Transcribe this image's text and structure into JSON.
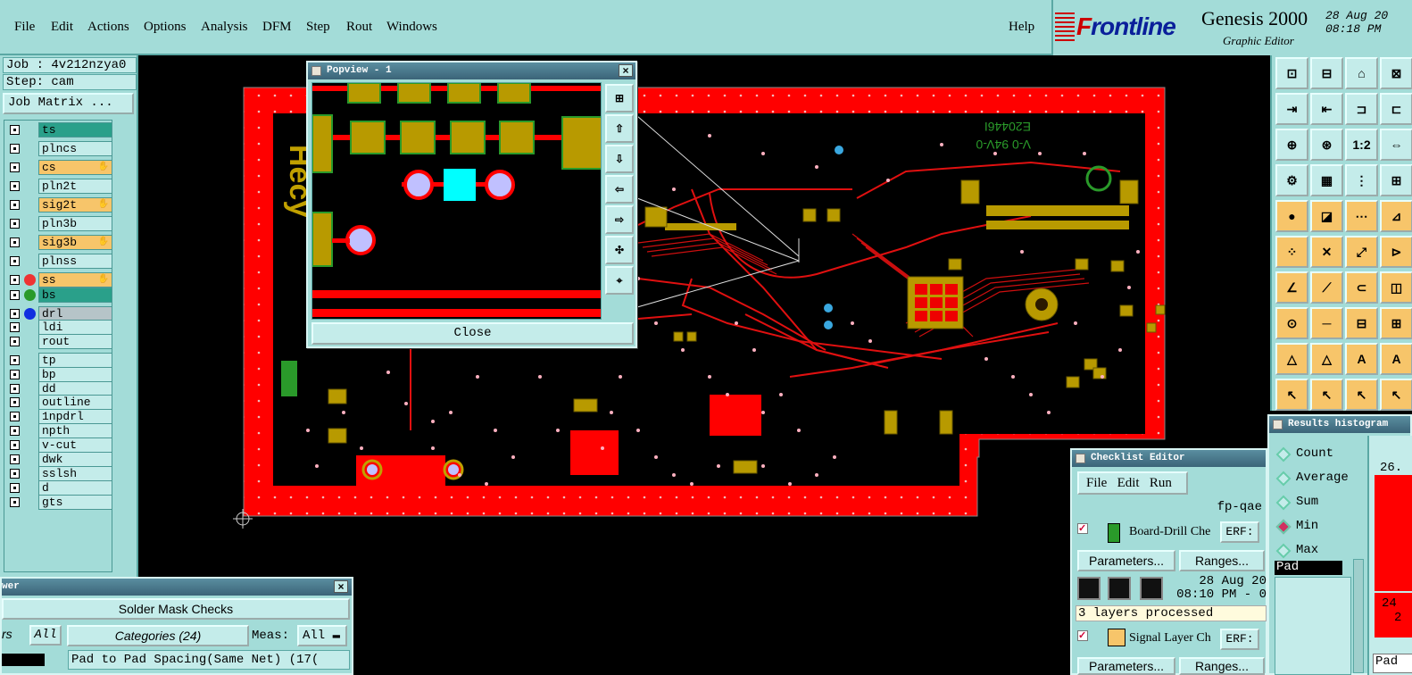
{
  "menu": {
    "items": [
      "File",
      "Edit",
      "Actions",
      "Options",
      "Analysis",
      "DFM",
      "Step",
      "Rout",
      "Windows"
    ],
    "help": "Help"
  },
  "brand": {
    "logo_prefix": "F",
    "logo_rest": "rontline",
    "product": "Genesis 2000",
    "subtitle": "Graphic Editor",
    "date": "28 Aug 20",
    "time": "08:18 PM"
  },
  "job": {
    "job_label": "Job : 4v212nzya0",
    "step_label": "Step: cam",
    "matrix_button": "Job Matrix ..."
  },
  "layers": [
    {
      "name": "ts",
      "color": "#2aa08a",
      "dot": ""
    },
    {
      "name": "plncs",
      "color": "#c4ecea",
      "dot": ""
    },
    {
      "name": "cs",
      "color": "#f7c56a",
      "dot": "",
      "hand": true
    },
    {
      "name": "pln2t",
      "color": "#c4ecea",
      "dot": ""
    },
    {
      "name": "sig2t",
      "color": "#f7c56a",
      "dot": "",
      "hand": true
    },
    {
      "name": "pln3b",
      "color": "#c4ecea",
      "dot": ""
    },
    {
      "name": "sig3b",
      "color": "#f7c56a",
      "dot": "",
      "hand": true
    },
    {
      "name": "plnss",
      "color": "#c4ecea",
      "dot": ""
    },
    {
      "name": "ss",
      "color": "#f7c56a",
      "dot": "#e33",
      "hand": true
    },
    {
      "name": "bs",
      "color": "#2aa08a",
      "dot": "#2a9a2a"
    },
    {
      "name": "drl",
      "color": "#b6c4c8",
      "dot": "#1030e0"
    },
    {
      "name": "ldi",
      "color": "#c4ecea",
      "dot": ""
    },
    {
      "name": "rout",
      "color": "#c4ecea",
      "dot": ""
    },
    {
      "name": "tp",
      "color": "#c4ecea",
      "dot": ""
    },
    {
      "name": "bp",
      "color": "#c4ecea",
      "dot": ""
    },
    {
      "name": "dd",
      "color": "#c4ecea",
      "dot": ""
    },
    {
      "name": "outline",
      "color": "#c4ecea",
      "dot": ""
    },
    {
      "name": "1npdrl",
      "color": "#c4ecea",
      "dot": ""
    },
    {
      "name": "npth",
      "color": "#c4ecea",
      "dot": ""
    },
    {
      "name": "v-cut",
      "color": "#c4ecea",
      "dot": ""
    },
    {
      "name": "dwk",
      "color": "#c4ecea",
      "dot": ""
    },
    {
      "name": "sslsh",
      "color": "#c4ecea",
      "dot": ""
    },
    {
      "name": "d",
      "color": "#c4ecea",
      "dot": ""
    },
    {
      "name": "gts",
      "color": "#c4ecea",
      "dot": ""
    }
  ],
  "popview": {
    "title": "Popview - 1",
    "close_label": "Close"
  },
  "checker": {
    "title_fragment": "wer",
    "section": "Solder Mask Checks",
    "rs_fragment": "rs",
    "all_button": "All",
    "categories": "Categories (24)",
    "meas_label": "Meas:",
    "meas_value": "All",
    "row1": "Pad to Pad Spacing(Same Net) (17("
  },
  "checklist": {
    "title": "Checklist Editor",
    "menu": [
      "File",
      "Edit",
      "Run"
    ],
    "name": "fp-qae",
    "item1": "Board-Drill Che",
    "erf": "ERF:",
    "params": "Parameters...",
    "ranges": "Ranges...",
    "date": "28 Aug 20",
    "time": "08:10 PM - 0",
    "status": "3 layers processed",
    "item2": "Signal Layer Ch",
    "params2": "Parameters...",
    "ranges2": "Ranges..."
  },
  "histogram": {
    "title": "Results histogram",
    "options": [
      "Count",
      "Average",
      "Sum",
      "Min",
      "Max"
    ],
    "selected": "Min",
    "value1": "26.",
    "value2": "24",
    "value3": "2",
    "field": "Pad",
    "field2": "Pad"
  }
}
